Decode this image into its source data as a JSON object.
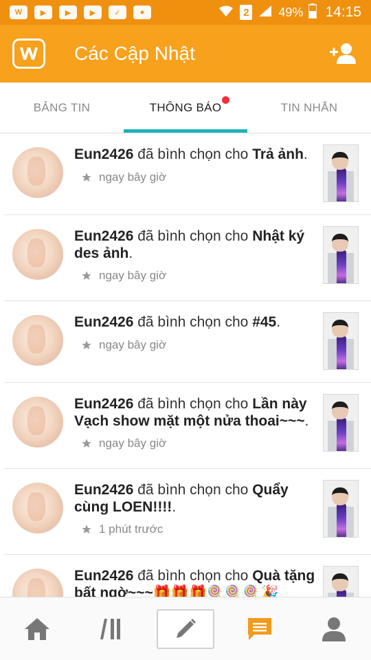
{
  "status_bar": {
    "battery": "49%",
    "time": "14:15",
    "sim": "2"
  },
  "app_bar": {
    "title": "Các Cập Nhật"
  },
  "tabs": [
    {
      "label": "BẢNG TIN"
    },
    {
      "label": "THÔNG BÁO"
    },
    {
      "label": "TIN NHẮN"
    }
  ],
  "notifications": [
    {
      "user": "Eun2426",
      "action": " đã bình chọn cho ",
      "target": "Trả ảnh",
      "end": ".",
      "time": "ngay bây giờ"
    },
    {
      "user": "Eun2426",
      "action": " đã bình chọn cho ",
      "target": "Nhật ký des ảnh",
      "end": ".",
      "time": "ngay bây giờ"
    },
    {
      "user": "Eun2426",
      "action": " đã bình chọn cho ",
      "target": "#45",
      "end": ".",
      "time": "ngay bây giờ"
    },
    {
      "user": "Eun2426",
      "action": " đã bình chọn cho ",
      "target": "Lần này Vạch show mặt một nửa thoai~~~",
      "end": ".",
      "time": "ngay bây giờ"
    },
    {
      "user": "Eun2426",
      "action": " đã bình chọn cho ",
      "target": "Quẩy cùng LOEN!!!!",
      "end": ".",
      "time": "1 phút trước"
    },
    {
      "user": "Eun2426",
      "action": " đã bình chọn cho ",
      "target": "Quà tặng bất ngờ~~~🎁🎁🎁🍭🍭🍭🎉",
      "end": "",
      "time": ""
    }
  ],
  "colors": {
    "status_bar": "#f0900f",
    "app_bar": "#f7a11c",
    "tab_indicator": "#1eb3b7",
    "badge": "#f0303a",
    "active_nav": "#f39a1c"
  }
}
